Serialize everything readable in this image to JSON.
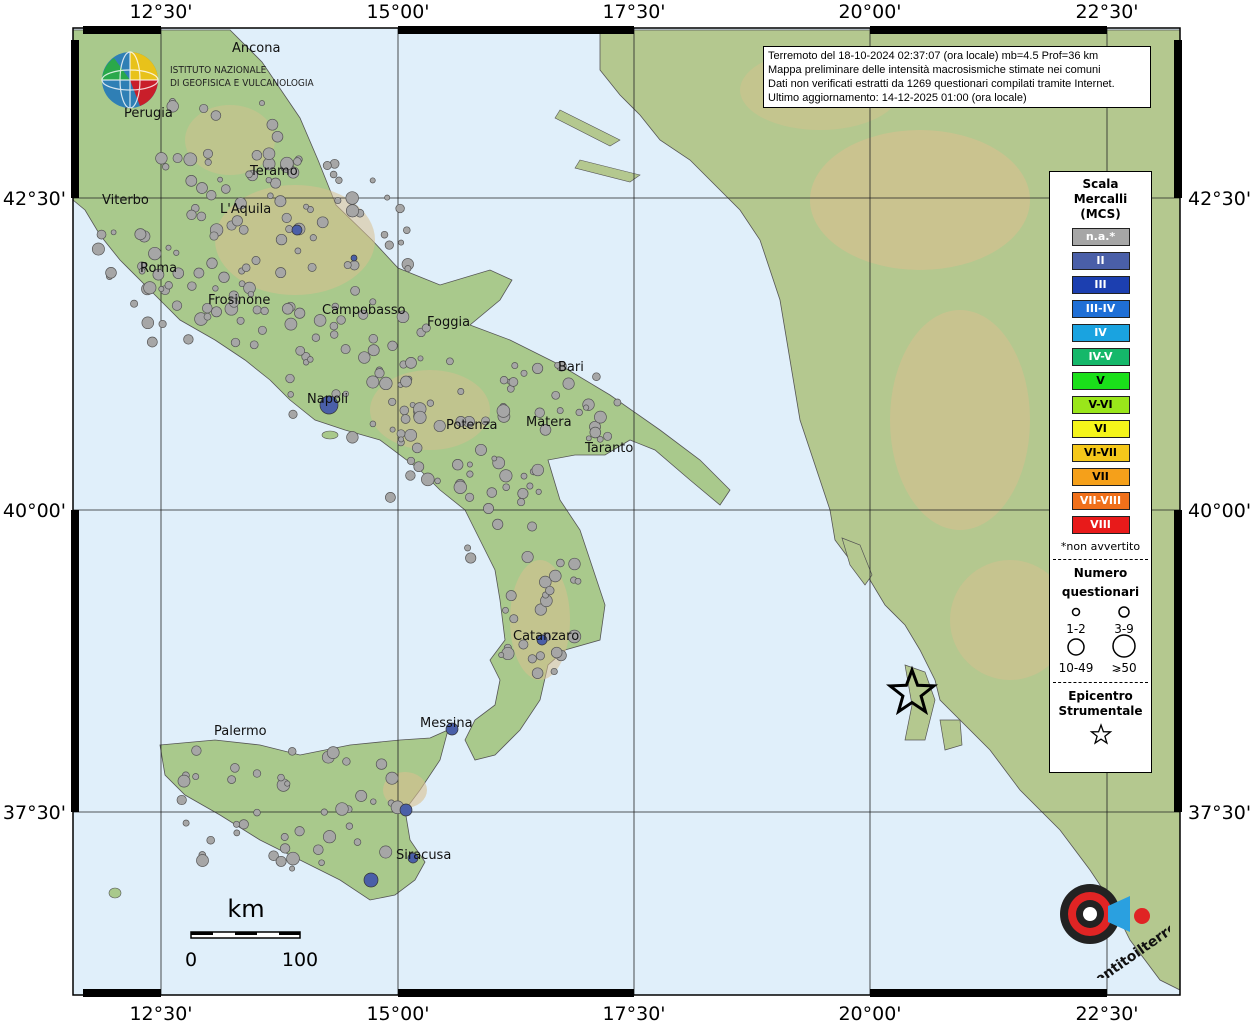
{
  "header": {
    "info_lines": [
      "Terremoto del 18-10-2024 02:37:07 (ora locale) mb=4.5 Prof=36 km",
      "Mappa preliminare delle intensità macrosismiche stimate nei comuni",
      "Dati non verificati estratti da 1269 questionari compilati tramite Internet.",
      "Ultimo aggiornamento: 14-12-2025 01:00 (ora locale)"
    ]
  },
  "logo_ingv": {
    "line1": "ISTITUTO NAZIONALE",
    "line2": "DI GEOFISICA E VULCANOLOGIA"
  },
  "logo_hst": {
    "text": "www.haisentitoilterremoto.it"
  },
  "axes": {
    "lon_ticks": [
      "12°30'",
      "15°00'",
      "17°30'",
      "20°00'",
      "22°30'"
    ],
    "lat_ticks": [
      "42°30'",
      "40°00'",
      "37°30'"
    ]
  },
  "scale_bar": {
    "unit": "km",
    "min": "0",
    "max": "100"
  },
  "cities": [
    "Ancona",
    "Perugia",
    "Teramo",
    "Viterbo",
    "L'Aquila",
    "Roma",
    "Frosinone",
    "Campobasso",
    "Foggia",
    "Bari",
    "Napoli",
    "Matera",
    "Potenza",
    "Taranto",
    "Catanzaro",
    "Palermo",
    "Messina",
    "Siracusa"
  ],
  "legend": {
    "title": [
      "Scala",
      "Mercalli",
      "(MCS)"
    ],
    "classes": [
      {
        "label": "n.a.*",
        "color": "#a6a6a6"
      },
      {
        "label": "II",
        "color": "#4a5fa8"
      },
      {
        "label": "III",
        "color": "#1c3fb0"
      },
      {
        "label": "III-IV",
        "color": "#1f6fd6"
      },
      {
        "label": "IV",
        "color": "#1aa3e0"
      },
      {
        "label": "IV-V",
        "color": "#15b86a"
      },
      {
        "label": "V",
        "color": "#1adf1a"
      },
      {
        "label": "V-VI",
        "color": "#9ae61a"
      },
      {
        "label": "VI",
        "color": "#f5f51a"
      },
      {
        "label": "VI-VII",
        "color": "#f5c81a"
      },
      {
        "label": "VII",
        "color": "#f5a01a"
      },
      {
        "label": "VII-VIII",
        "color": "#f0701a"
      },
      {
        "label": "VIII",
        "color": "#e81a1a"
      }
    ],
    "note": "*non avvertito",
    "count_title": [
      "Numero",
      "questionari"
    ],
    "count_classes": [
      "1-2",
      "3-9",
      "10-49",
      "⩾50"
    ],
    "epicenter_title": [
      "Epicentro",
      "Strumentale"
    ]
  },
  "colors": {
    "sea": "#ddeefa",
    "land": "#a9c98c",
    "highland": "#d9c08e",
    "frame": "#000000"
  }
}
